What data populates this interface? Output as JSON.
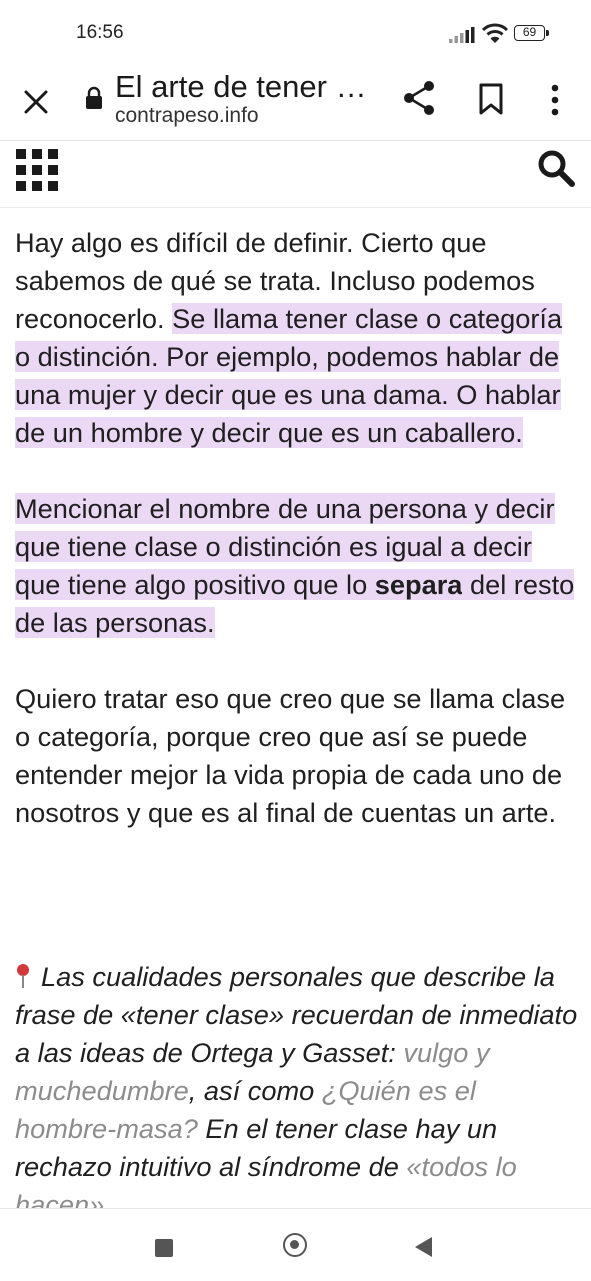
{
  "status_bar": {
    "time": "16:56",
    "battery": "69"
  },
  "toolbar": {
    "title": "El arte de tener …",
    "domain": "contrapeso.info"
  },
  "article": {
    "p1": {
      "plain": "Hay algo es difícil de definir. Cierto que sabemos de qué se trata. Incluso podemos reconocerlo. ",
      "highlight": "Se llama tener clase o categoría o distinción. Por ejemplo, podemos hablar de una mujer y decir que es una dama. O hablar de un hombre y decir que es un caballero."
    },
    "p2": {
      "highlight_a": "Mencionar el nombre de una persona y decir que tiene clase o distinción es igual a decir que tiene algo positivo que lo ",
      "bold": "separa",
      "highlight_b": " del resto de las personas."
    },
    "p3": "Quiero tratar eso que creo que se llama clase o categoría, porque creo que así se puede entender mejor la vida propia de cada uno de nosotros y que es al final de cuentas un arte.",
    "quote": {
      "a": "Las cualidades personales que describe la frase de «tener clase» recuerdan de inmediato a las ideas de Ortega y Gasset: ",
      "link1": "vulgo y muchedumbre",
      "b": ", así como ",
      "link2": "¿Quién es el hombre-masa?",
      "c": " En el tener clase hay un rechazo intuitivo al síndrome de ",
      "link3": "«todos lo hacen»"
    }
  },
  "icons": {
    "close": "close-icon",
    "lock": "lock-icon",
    "share": "share-icon",
    "bookmark": "bookmark-icon",
    "more": "more-vert-icon",
    "grid": "grid-menu-icon",
    "search": "search-icon",
    "pin": "pushpin-icon"
  },
  "colors": {
    "highlight": "#ead8f5",
    "link_muted": "#8c8c8c",
    "pin": "#d13a3a"
  }
}
